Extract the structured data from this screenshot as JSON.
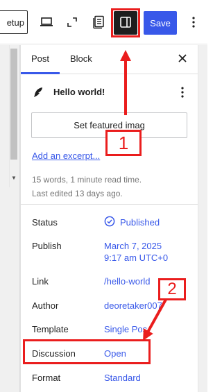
{
  "toolbar": {
    "setup_label": "etup",
    "save_label": "Save",
    "icons": [
      "desktop-icon",
      "external-link-icon",
      "document-overview-icon",
      "sidebar-toggle-icon",
      "more-vertical-icon"
    ]
  },
  "sidebar": {
    "tabs": [
      {
        "label": "Post",
        "active": true
      },
      {
        "label": "Block",
        "active": false
      }
    ],
    "post_title": "Hello world!",
    "featured_image_label": "Set featured imag",
    "excerpt_link": "Add an excerpt...",
    "stats": "15 words, 1 minute read time.",
    "last_edited": "Last edited 13 days ago.",
    "rows": [
      {
        "label": "Status",
        "value": "Published"
      },
      {
        "label": "Publish",
        "value": "March 7, 2025",
        "value2": "9:17 am UTC+0"
      },
      {
        "label": "Link",
        "value": "/hello-world"
      },
      {
        "label": "Author",
        "value": "deoretaker007"
      },
      {
        "label": "Template",
        "value": "Single Pos"
      },
      {
        "label": "Discussion",
        "value": "Open"
      },
      {
        "label": "Format",
        "value": "Standard"
      }
    ]
  },
  "annotations": {
    "marker_1": "1",
    "marker_2": "2"
  },
  "colors": {
    "accent": "#3858e9",
    "annotation": "#ea1d1d",
    "toggle_active": "#1e1e1e"
  }
}
